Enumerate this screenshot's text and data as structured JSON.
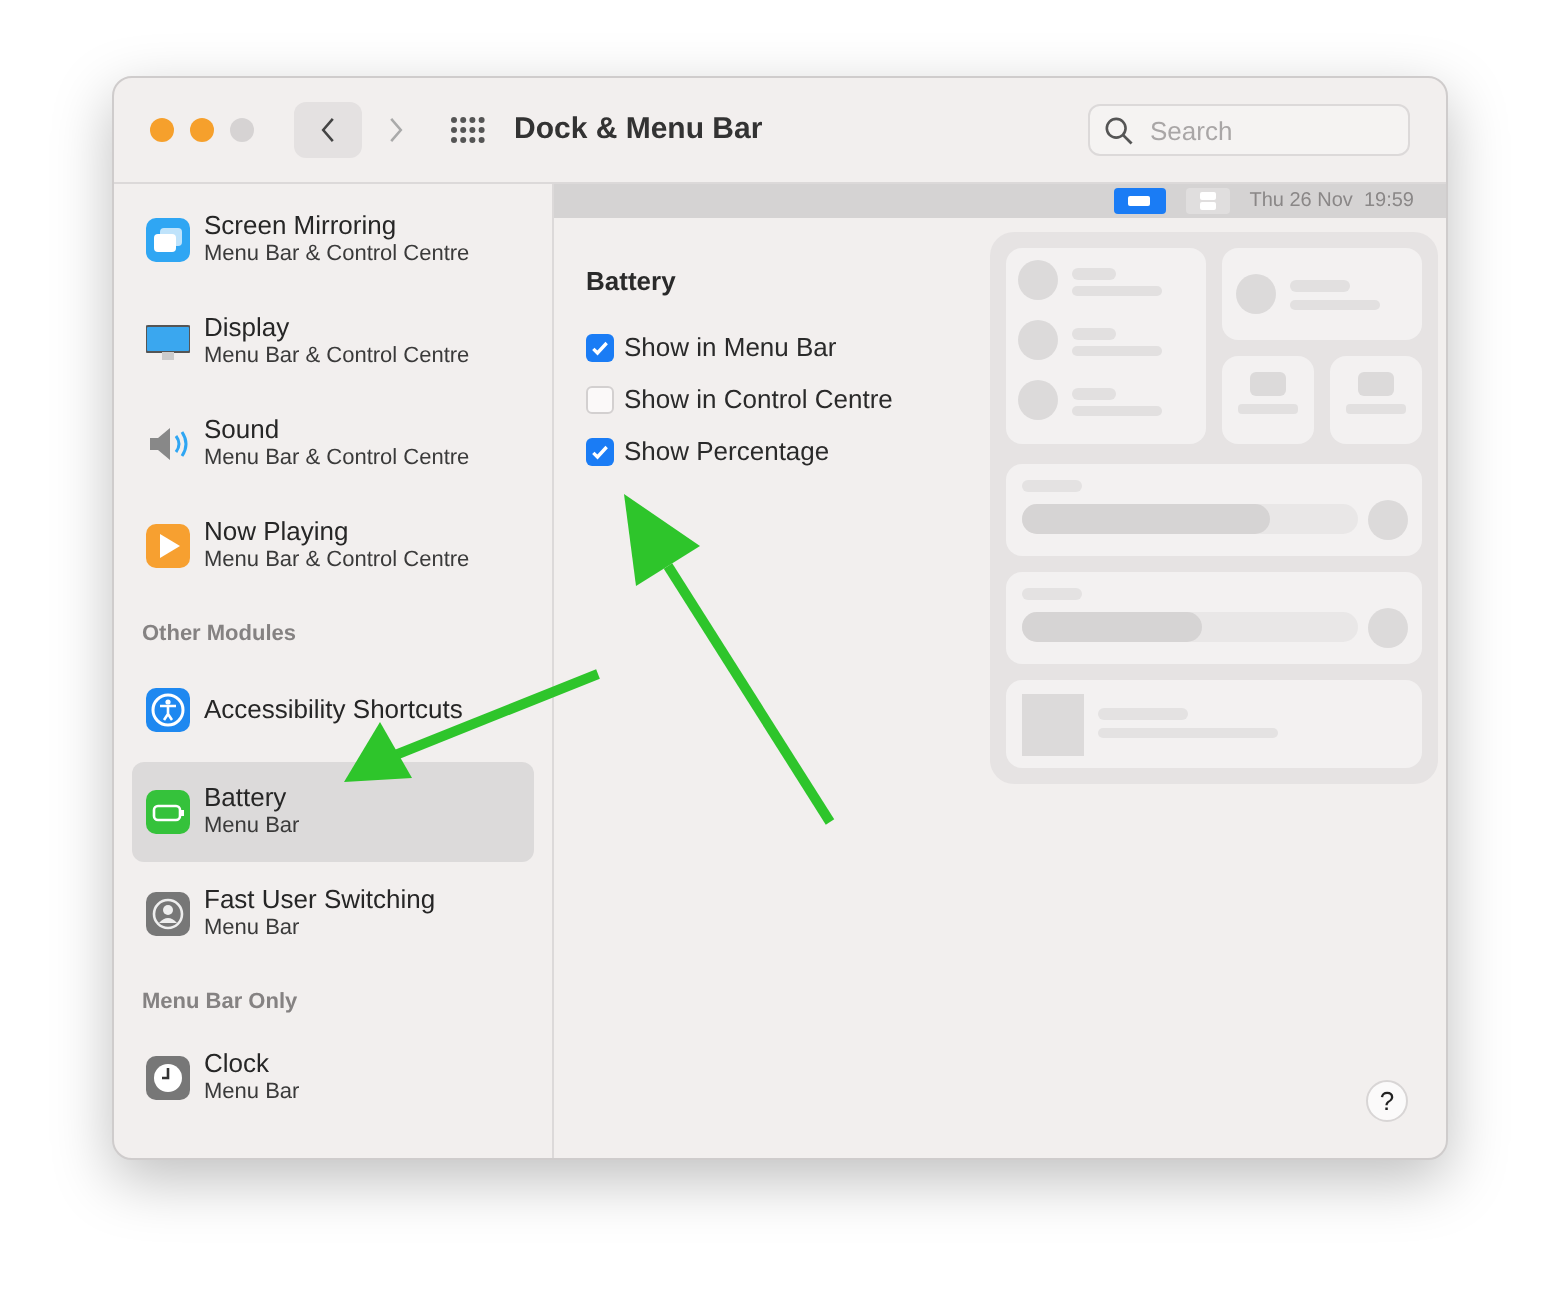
{
  "window": {
    "title": "Dock & Menu Bar"
  },
  "search": {
    "placeholder": "Search"
  },
  "sidebar": {
    "items": [
      {
        "kind": "module",
        "label": "Screen Mirroring",
        "subtitle": "Menu Bar & Control Centre",
        "selected": false
      },
      {
        "kind": "module",
        "label": "Display",
        "subtitle": "Menu Bar & Control Centre",
        "selected": false
      },
      {
        "kind": "module",
        "label": "Sound",
        "subtitle": "Menu Bar & Control Centre",
        "selected": false
      },
      {
        "kind": "module",
        "label": "Now Playing",
        "subtitle": "Menu Bar & Control Centre",
        "selected": false
      },
      {
        "kind": "heading",
        "label": "Other Modules"
      },
      {
        "kind": "module",
        "label": "Accessibility Shortcuts",
        "selected": false
      },
      {
        "kind": "module",
        "label": "Battery",
        "subtitle": "Menu Bar",
        "selected": true
      },
      {
        "kind": "module",
        "label": "Fast User Switching",
        "subtitle": "Menu Bar",
        "selected": false
      },
      {
        "kind": "heading",
        "label": "Menu Bar Only"
      },
      {
        "kind": "module",
        "label": "Clock",
        "subtitle": "Menu Bar",
        "selected": false
      }
    ]
  },
  "menu_bar_preview": {
    "date_time": "Thu 26 Nov  19:59"
  },
  "battery_section": {
    "title": "Battery",
    "options": [
      {
        "label": "Show in Menu Bar",
        "checked": true
      },
      {
        "label": "Show in Control Centre",
        "checked": false
      },
      {
        "label": "Show Percentage",
        "checked": true
      }
    ]
  },
  "help_button": {
    "label": "?"
  }
}
